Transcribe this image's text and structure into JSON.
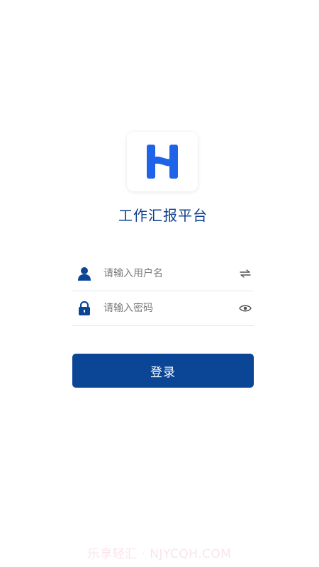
{
  "app": {
    "title": "工作汇报平台",
    "logo_icon": "letter-h-logo",
    "brand_color": "#1f63e8"
  },
  "form": {
    "username": {
      "placeholder": "请输入用户名",
      "value": "",
      "icon": "user-icon",
      "trailing_icon": "swap-icon"
    },
    "password": {
      "placeholder": "请输入密码",
      "value": "",
      "icon": "lock-icon",
      "trailing_icon": "eye-icon"
    },
    "submit_label": "登录",
    "accent_color": "#0b4596"
  },
  "watermark": {
    "text": "乐享轻汇 · NJYCQH.COM"
  }
}
